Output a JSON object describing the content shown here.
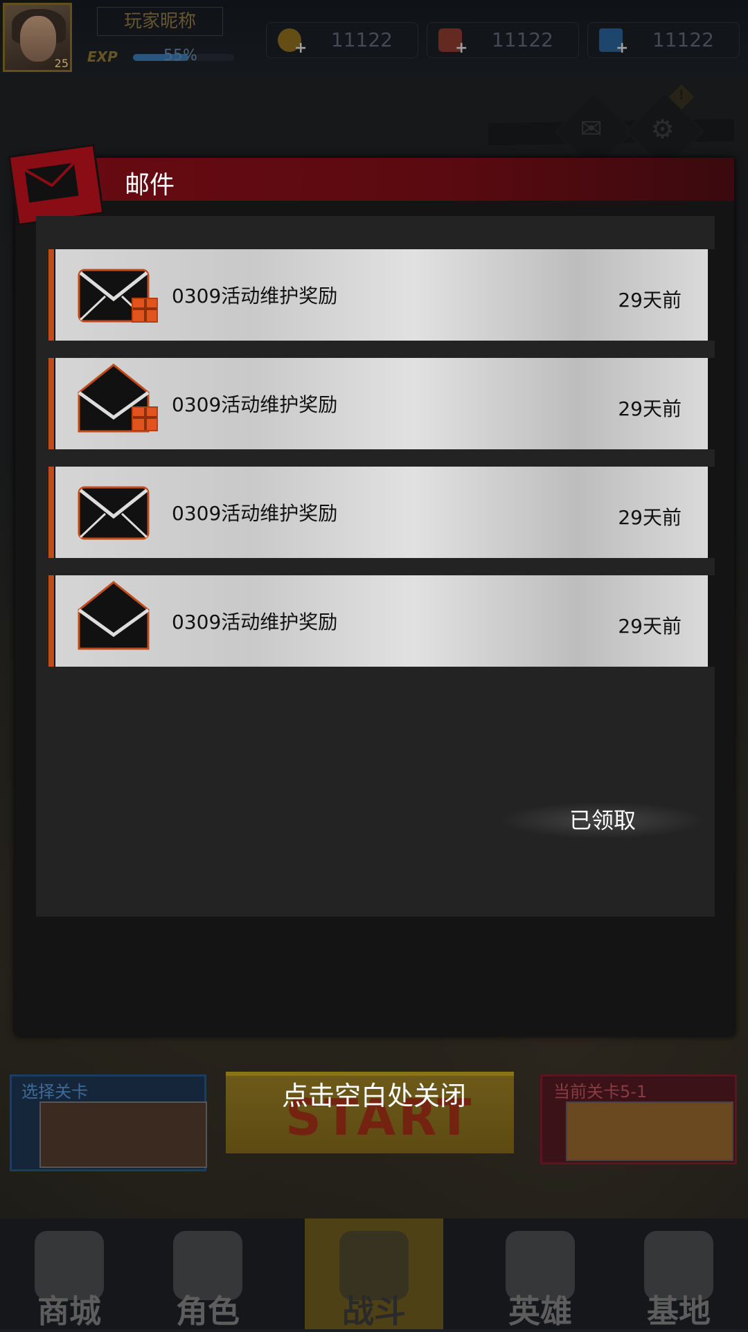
{
  "topbar": {
    "player_name": "玩家昵称",
    "level": "25",
    "exp_label": "EXP",
    "exp_percent": "55%",
    "exp_fraction": 0.55,
    "resources": [
      {
        "name": "gold-coin",
        "value": "11122",
        "color": "#8a6a1a"
      },
      {
        "name": "ticket",
        "value": "11122",
        "color": "#8a3a2a"
      },
      {
        "name": "diamond",
        "value": "11122",
        "color": "#2a5a8a"
      }
    ]
  },
  "mail": {
    "title": "邮件",
    "items": [
      {
        "name": "0309活动维护奖励",
        "time": "29天前",
        "opened": false,
        "has_gift": true
      },
      {
        "name": "0309活动维护奖励",
        "time": "29天前",
        "opened": true,
        "has_gift": true
      },
      {
        "name": "0309活动维护奖励",
        "time": "29天前",
        "opened": false,
        "has_gift": false
      },
      {
        "name": "0309活动维护奖励",
        "time": "29天前",
        "opened": true,
        "has_gift": false
      }
    ],
    "claimed_label": "已领取"
  },
  "close_hint": "点击空白处关闭",
  "stage": {
    "select_label": "选择关卡",
    "start_label": "START",
    "current_label": "当前关卡5-1"
  },
  "nav": {
    "tabs": [
      {
        "label": "商城",
        "icon": "shop-icon"
      },
      {
        "label": "角色",
        "icon": "character-icon"
      },
      {
        "label": "战斗",
        "icon": "battle-icon"
      },
      {
        "label": "英雄",
        "icon": "hero-icon"
      },
      {
        "label": "基地",
        "icon": "base-icon"
      }
    ]
  },
  "colors": {
    "header": "#6a0a12",
    "accent": "#c14b1a"
  }
}
